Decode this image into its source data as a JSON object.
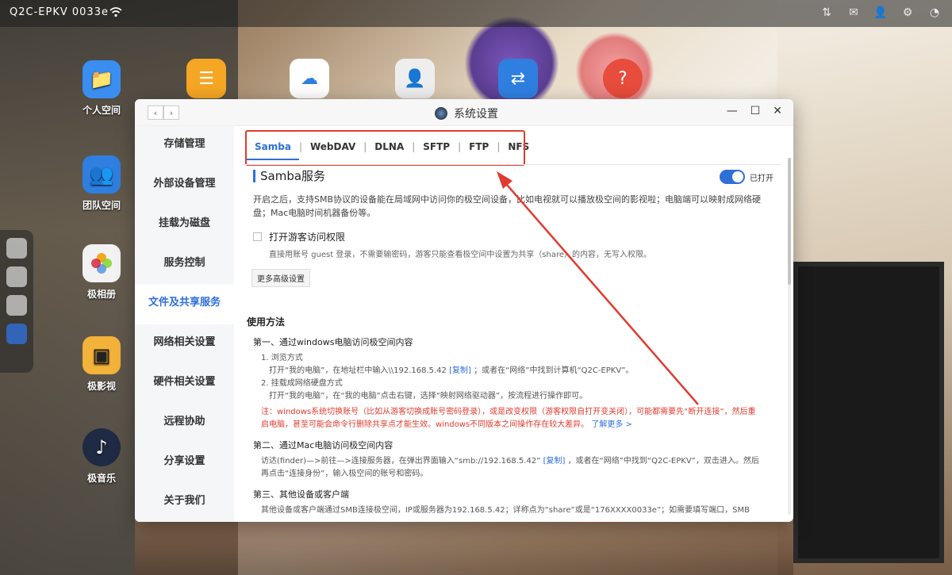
{
  "topbar": {
    "device_name": "Q2C-EPKV 0033e",
    "wifi_icon": "wifi-icon",
    "icons": [
      "sort-icon",
      "mail-icon",
      "user-icon",
      "gear-icon",
      "dashboard-icon"
    ]
  },
  "desktop": {
    "icons": [
      {
        "label": "个人空间",
        "icon": "folder-icon",
        "color": "#3a8ef0"
      },
      {
        "label": "团队空间",
        "icon": "team-folder-icon",
        "color": "#2f7fe0"
      },
      {
        "label": "极相册",
        "icon": "photos-icon",
        "color": "#f2f2f2"
      },
      {
        "label": "极影视",
        "icon": "video-icon",
        "color": "#f3b23a"
      },
      {
        "label": "极音乐",
        "icon": "music-icon",
        "color": "#1f2a44"
      }
    ],
    "apps": [
      "notes-icon",
      "download-icon",
      "contact-icon",
      "transfer-icon",
      "help-icon"
    ]
  },
  "window": {
    "title": "系统设置",
    "controls": {
      "minimize": "—",
      "maximize": "☐",
      "close": "✕"
    }
  },
  "menu": {
    "items": [
      "存储管理",
      "外部设备管理",
      "挂载为磁盘",
      "服务控制",
      "文件及共享服务",
      "网络相关设置",
      "硬件相关设置",
      "远程协助",
      "分享设置",
      "关于我们"
    ],
    "active_index": 4
  },
  "tabs": [
    "Samba",
    "WebDAV",
    "DLNA",
    "SFTP",
    "FTP",
    "NFS"
  ],
  "samba": {
    "title": "Samba服务",
    "toggle_label": "已打开",
    "description": "开启之后，支持SMB协议的设备能在局域网中访问你的极空间设备，比如电视就可以播放极空间的影视啦；电脑端可以映射成网络硬盘；Mac电脑时间机器备份等。",
    "guest_label": "打开游客访问权限",
    "guest_hint": "直接用账号 guest 登录，不需要输密码，游客只能查看极空间中设置为共享（share）的内容，无写入权限。",
    "advanced_button": "更多高级设置"
  },
  "usage": {
    "title": "使用方法",
    "step1_title": "第一、通过windows电脑访问极空间内容",
    "step1_a_title": "1. 浏览方式",
    "step1_a_pre": "打开“我的电脑”，在地址栏中输入\\\\192.168.5.42",
    "step1_a_link": "[复制]",
    "step1_a_post": "；或者在“网络”中找到计算机“Q2C-EPKV”。",
    "step1_b_title": "2. 挂载成网络硬盘方式",
    "step1_b_text": "打开“我的电脑”，在“我的电脑”点击右键，选择“映射网络驱动器”，按流程进行操作即可。",
    "note_line1": "注：windows系统切换账号（比如从游客切换成账号密码登录），或是改变权限（游客权限自打开变关闭），可能都需要先“断开连接”，然后重",
    "note_line2_pre": "启电脑，甚至可能会命令行删除共享点才能生效。windows不同版本之间操作存在较大差异。",
    "note_link": "了解更多 >",
    "step2_title": "第二、通过Mac电脑访问极空间内容",
    "step2_pre": "访达(finder)—>前往—>连接服务器，在弹出界面输入“smb://192.168.5.42”",
    "step2_link": "[复制]",
    "step2_post": "，或者在“网络”中找到“Q2C-EPKV”，双击进入。然后",
    "step2_line2": "再点击“连接身份”，输入极空间的账号和密码。",
    "step3_title": "第三、其他设备或客户端",
    "step3_text": "其他设备或客户端通过SMB连接极空间，IP或服务器为192.168.5.42；详称点为“share”或是“176XXXX0033e”；如需要填写端口，SMB"
  }
}
